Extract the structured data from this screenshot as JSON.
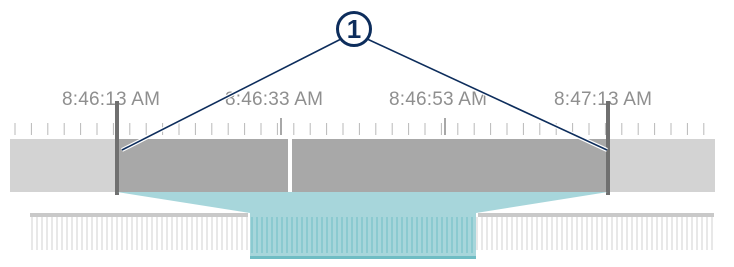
{
  "timeline": {
    "time_labels": [
      "8:46:13 AM",
      "8:46:33 AM",
      "8:46:53 AM",
      "8:47:13 AM"
    ]
  },
  "callout": {
    "number": "1"
  },
  "colors": {
    "track_outer": "#d3d3d3",
    "track_selected": "#a8a8a8",
    "highlight": "#a7d6db",
    "callout": "#0d2d5c"
  }
}
